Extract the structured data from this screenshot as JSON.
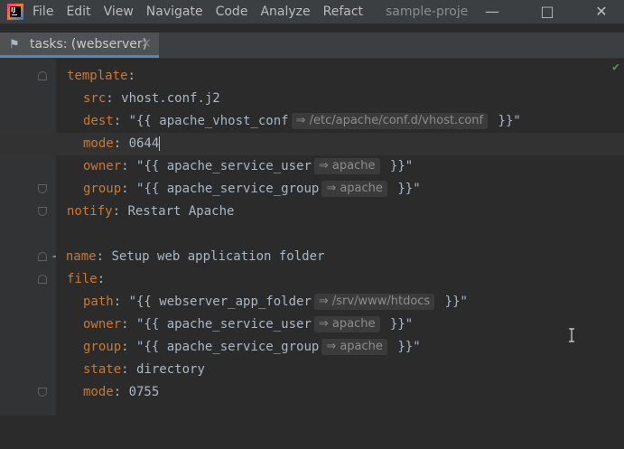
{
  "titlebar": {
    "menu": [
      "File",
      "Edit",
      "View",
      "Navigate",
      "Code",
      "Analyze",
      "Refact"
    ],
    "project": "sample-proje"
  },
  "tab": {
    "label": "tasks: (webserver)",
    "close": "×"
  },
  "editor": {
    "lines": [
      {
        "indent": "",
        "key": "template",
        "sep": ":"
      },
      {
        "indent": "  ",
        "key": "src",
        "sep": ": ",
        "value": "vhost.conf.j2"
      },
      {
        "indent": "  ",
        "key": "dest",
        "sep": ": ",
        "pre": "\"{{ ",
        "var": "apache_vhost_conf",
        "hint": "⇒ /etc/apache/conf.d/vhost.conf",
        "post": " }}\""
      },
      {
        "indent": "  ",
        "key": "mode",
        "sep": ": ",
        "value": "0644"
      },
      {
        "indent": "  ",
        "key": "owner",
        "sep": ": ",
        "pre": "\"{{ ",
        "var": "apache_service_user",
        "hint": "⇒ apache",
        "post": " }}\""
      },
      {
        "indent": "  ",
        "key": "group",
        "sep": ": ",
        "pre": "\"{{ ",
        "var": "apache_service_group",
        "hint": "⇒ apache",
        "post": " }}\""
      },
      {
        "indent": "",
        "key": "notify",
        "sep": ": ",
        "value": "Restart Apache"
      },
      {
        "indent": "",
        "key": "",
        "sep": "",
        "value": ""
      },
      {
        "indent": "",
        "dash": "- ",
        "key": "name",
        "sep": ": ",
        "value": "Setup web application folder"
      },
      {
        "indent": "",
        "key": "file",
        "sep": ":"
      },
      {
        "indent": "  ",
        "key": "path",
        "sep": ": ",
        "pre": "\"{{ ",
        "var": "webserver_app_folder",
        "hint": "⇒ /srv/www/htdocs",
        "post": " }}\""
      },
      {
        "indent": "  ",
        "key": "owner",
        "sep": ": ",
        "pre": "\"{{ ",
        "var": "apache_service_user",
        "hint": "⇒ apache",
        "post": " }}\""
      },
      {
        "indent": "  ",
        "key": "group",
        "sep": ": ",
        "pre": "\"{{ ",
        "var": "apache_service_group",
        "hint": "⇒ apache",
        "post": " }}\""
      },
      {
        "indent": "  ",
        "key": "state",
        "sep": ": ",
        "value": "directory"
      },
      {
        "indent": "  ",
        "key": "mode",
        "sep": ": ",
        "value": "0755"
      }
    ]
  },
  "colors": {
    "accent": "#4a88c7",
    "keyword": "#cc7832",
    "bg": "#2b2b2b"
  }
}
